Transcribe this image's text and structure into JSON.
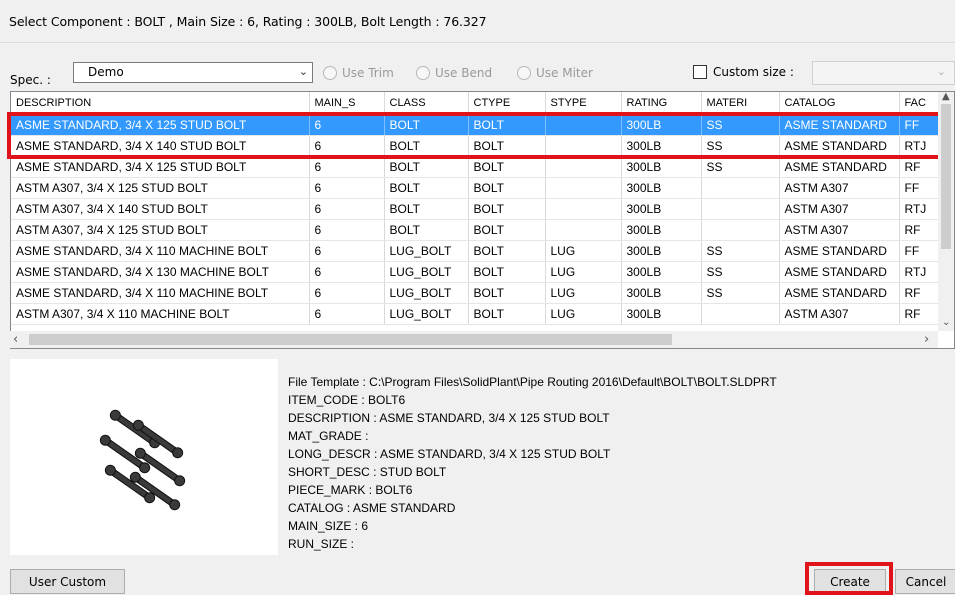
{
  "title": "Select Component : BOLT , Main Size : 6, Rating : 300LB, Bolt Length : 76.327",
  "spec": {
    "label": "Spec. :",
    "value": "Demo"
  },
  "options": {
    "use_trim": "Use Trim",
    "use_bend": "Use Bend",
    "use_miter": "Use Miter",
    "custom_size": "Custom size :"
  },
  "table": {
    "headers": [
      "DESCRIPTION",
      "MAIN_S",
      "CLASS",
      "CTYPE",
      "STYPE",
      "RATING",
      "MATERI",
      "CATALOG",
      "FAC"
    ],
    "rows": [
      [
        "ASME STANDARD, 3/4 X 125 STUD BOLT",
        "6",
        "BOLT",
        "BOLT",
        "",
        "300LB",
        "SS",
        "ASME STANDARD",
        "FF"
      ],
      [
        "ASME STANDARD, 3/4 X 140 STUD BOLT",
        "6",
        "BOLT",
        "BOLT",
        "",
        "300LB",
        "SS",
        "ASME STANDARD",
        "RTJ"
      ],
      [
        "ASME STANDARD, 3/4 X 125 STUD BOLT",
        "6",
        "BOLT",
        "BOLT",
        "",
        "300LB",
        "SS",
        "ASME STANDARD",
        "RF"
      ],
      [
        "ASTM A307, 3/4 X 125 STUD BOLT",
        "6",
        "BOLT",
        "BOLT",
        "",
        "300LB",
        "",
        "ASTM A307",
        "FF"
      ],
      [
        "ASTM A307, 3/4 X 140 STUD BOLT",
        "6",
        "BOLT",
        "BOLT",
        "",
        "300LB",
        "",
        "ASTM A307",
        "RTJ"
      ],
      [
        "ASTM A307, 3/4 X 125 STUD BOLT",
        "6",
        "BOLT",
        "BOLT",
        "",
        "300LB",
        "",
        "ASTM A307",
        "RF"
      ],
      [
        "ASME STANDARD, 3/4 X 110 MACHINE BOLT",
        "6",
        "LUG_BOLT",
        "BOLT",
        "LUG",
        "300LB",
        "SS",
        "ASME STANDARD",
        "FF"
      ],
      [
        "ASME STANDARD, 3/4 X 130 MACHINE BOLT",
        "6",
        "LUG_BOLT",
        "BOLT",
        "LUG",
        "300LB",
        "SS",
        "ASME STANDARD",
        "RTJ"
      ],
      [
        "ASME STANDARD, 3/4 X 110 MACHINE BOLT",
        "6",
        "LUG_BOLT",
        "BOLT",
        "LUG",
        "300LB",
        "SS",
        "ASME STANDARD",
        "RF"
      ],
      [
        "ASTM A307, 3/4 X 110 MACHINE BOLT",
        "6",
        "LUG_BOLT",
        "BOLT",
        "LUG",
        "300LB",
        "",
        "ASTM A307",
        "RF"
      ]
    ]
  },
  "details": [
    "File Template : C:\\Program Files\\SolidPlant\\Pipe Routing 2016\\Default\\BOLT\\BOLT.SLDPRT",
    "ITEM_CODE : BOLT6",
    "DESCRIPTION : ASME STANDARD, 3/4 X 125 STUD BOLT",
    "MAT_GRADE :",
    "LONG_DESCR : ASME STANDARD, 3/4 X 125 STUD BOLT",
    "SHORT_DESC : STUD BOLT",
    "PIECE_MARK : BOLT6",
    "CATALOG : ASME STANDARD",
    "MAIN_SIZE : 6",
    "RUN_SIZE :"
  ],
  "buttons": {
    "user_custom": "User Custom",
    "create": "Create",
    "cancel": "Cancel"
  },
  "colors": {
    "selection": "#3399ff",
    "highlight_box": "#e0121a"
  },
  "icons": {
    "preview": "bolt-set-preview-icon"
  }
}
